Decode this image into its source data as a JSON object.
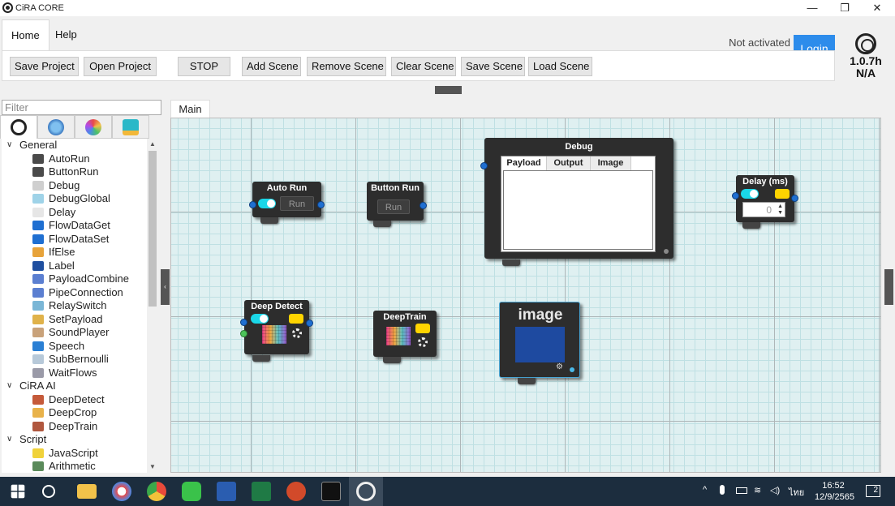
{
  "window": {
    "title": "CiRA CORE",
    "minimize": "—",
    "restore": "❐",
    "close": "✕"
  },
  "ribbon": {
    "tabs": [
      "Home",
      "Help"
    ],
    "buttons": {
      "save_project": "Save Project",
      "open_project": "Open Project",
      "stop": "STOP",
      "add_scene": "Add Scene",
      "remove_scene": "Remove Scene",
      "clear_scene": "Clear Scene",
      "save_scene": "Save Scene",
      "load_scene": "Load Scene"
    },
    "status": "Not activated",
    "status_sub": "-",
    "login": "Login",
    "version": "1.0.7h",
    "version_sub": "N/A"
  },
  "sidebar": {
    "filter_placeholder": "Filter",
    "tab_icons": [
      "cira-logo-icon",
      "monitor-icon",
      "network-icon",
      "chat-icon"
    ],
    "groups": [
      {
        "label": "General",
        "items": [
          {
            "label": "AutoRun",
            "icon": "autorun-icon",
            "color": "#4a4a4a"
          },
          {
            "label": "ButtonRun",
            "icon": "buttonrun-icon",
            "color": "#4a4a4a"
          },
          {
            "label": "Debug",
            "icon": "debug-icon",
            "color": "#cfcfcf"
          },
          {
            "label": "DebugGlobal",
            "icon": "debug-global-icon",
            "color": "#9fd3e8"
          },
          {
            "label": "Delay",
            "icon": "clock-icon",
            "color": "#e6e6e6"
          },
          {
            "label": "FlowDataGet",
            "icon": "flow-get-icon",
            "color": "#1f6fd1"
          },
          {
            "label": "FlowDataSet",
            "icon": "flow-set-icon",
            "color": "#1f6fd1"
          },
          {
            "label": "IfElse",
            "icon": "ifelse-icon",
            "color": "#e7a33a"
          },
          {
            "label": "Label",
            "icon": "label-icon",
            "color": "#1f4fa0"
          },
          {
            "label": "PayloadCombine",
            "icon": "combine-icon",
            "color": "#5b7fd1"
          },
          {
            "label": "PipeConnection",
            "icon": "pipe-icon",
            "color": "#5b7fd1"
          },
          {
            "label": "RelaySwitch",
            "icon": "relay-icon",
            "color": "#7ab6d6"
          },
          {
            "label": "SetPayload",
            "icon": "box-icon",
            "color": "#e0b24a"
          },
          {
            "label": "SoundPlayer",
            "icon": "sound-icon",
            "color": "#c9a27a"
          },
          {
            "label": "Speech",
            "icon": "speech-icon",
            "color": "#2a7fd4"
          },
          {
            "label": "SubBernoulli",
            "icon": "subbernoulli-icon",
            "color": "#b7c9d9"
          },
          {
            "label": "WaitFlows",
            "icon": "hourglass-icon",
            "color": "#9a9aa8"
          }
        ]
      },
      {
        "label": "CiRA AI",
        "items": [
          {
            "label": "DeepDetect",
            "icon": "deepdetect-icon",
            "color": "#c55a3a"
          },
          {
            "label": "DeepCrop",
            "icon": "deepcrop-icon",
            "color": "#e8b24a"
          },
          {
            "label": "DeepTrain",
            "icon": "deeptrain-icon",
            "color": "#b0573e"
          }
        ]
      },
      {
        "label": "Script",
        "items": [
          {
            "label": "JavaScript",
            "icon": "js-icon",
            "color": "#f0d23a"
          },
          {
            "label": "Arithmetic",
            "icon": "arithmetic-icon",
            "color": "#5a8a5a"
          }
        ]
      }
    ]
  },
  "canvas": {
    "scene_tab": "Main",
    "nodes": {
      "autorun": {
        "title": "Auto Run",
        "button": "Run"
      },
      "buttonrun": {
        "title": "Button Run",
        "button": "Run"
      },
      "debug": {
        "title": "Debug",
        "tabs": [
          "Payload",
          "Output",
          "Image"
        ]
      },
      "delay": {
        "title": "Delay (ms)",
        "value": "0"
      },
      "deepdetect": {
        "title": "Deep Detect"
      },
      "deeptrain": {
        "title": "DeepTrain"
      },
      "image": {
        "title": "image"
      }
    }
  },
  "taskbar": {
    "apps": [
      "windows-start-icon",
      "search-icon",
      "file-explorer-icon",
      "paint-icon",
      "chrome-icon",
      "line-icon",
      "word-icon",
      "excel-icon",
      "powerpoint-icon",
      "terminal-icon",
      "cira-core-icon"
    ],
    "language": "ไทย",
    "time": "16:52",
    "date": "12/9/2565",
    "notifications": "2"
  }
}
